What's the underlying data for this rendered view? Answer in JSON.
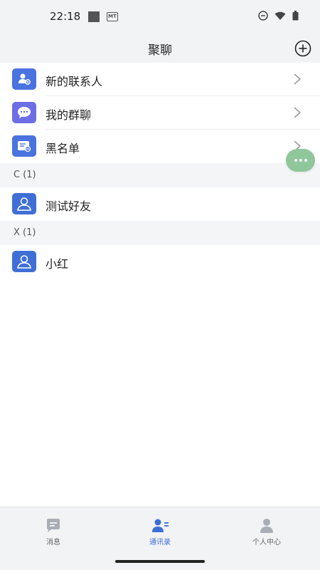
{
  "status_bar": {
    "time": "22:18",
    "mt_label": "MT"
  },
  "header": {
    "title": "聚聊",
    "add_icon": "plus-circle-icon"
  },
  "menu_items": [
    {
      "label": "新的联系人",
      "icon": "new-contact-icon",
      "color": "#4a73e0"
    },
    {
      "label": "我的群聊",
      "icon": "group-chat-icon",
      "color": "#6e6ee6"
    },
    {
      "label": "黑名单",
      "icon": "blacklist-icon",
      "color": "#4a73e0"
    }
  ],
  "groups": [
    {
      "header": "C (1)",
      "contacts": [
        {
          "name": "测试好友"
        }
      ]
    },
    {
      "header": "X (1)",
      "contacts": [
        {
          "name": "小红"
        }
      ]
    }
  ],
  "fab": {
    "icon": "more-dots-icon",
    "color": "#8fc79a"
  },
  "tabs": [
    {
      "label": "消息",
      "icon": "message-icon",
      "active": false
    },
    {
      "label": "通讯录",
      "icon": "contacts-icon",
      "active": true
    },
    {
      "label": "个人中心",
      "icon": "profile-icon",
      "active": false
    }
  ],
  "colors": {
    "accent": "#3b6fd8",
    "avatar_blue": "#4a73e0"
  }
}
